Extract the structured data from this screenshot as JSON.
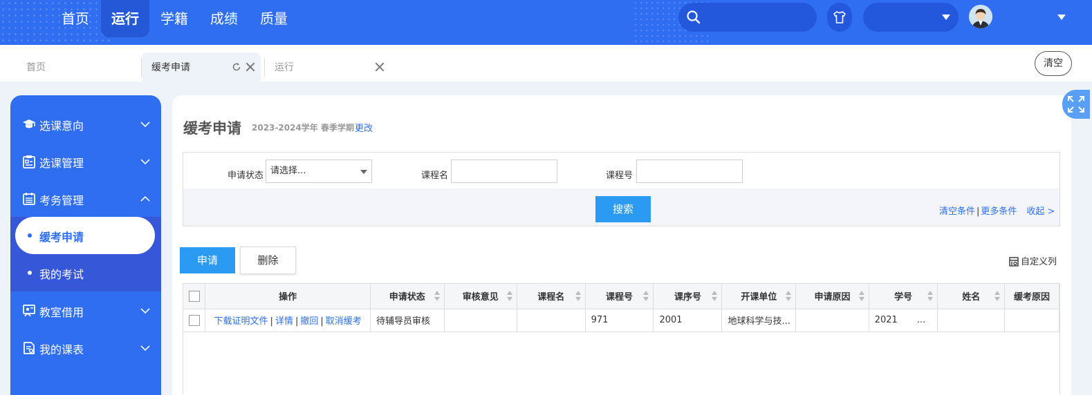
{
  "topnav": {
    "items": [
      {
        "label": "首页",
        "active": false
      },
      {
        "label": "运行",
        "active": true
      },
      {
        "label": "学籍",
        "active": false
      },
      {
        "label": "成绩",
        "active": false
      },
      {
        "label": "质量",
        "active": false
      }
    ],
    "search_placeholder": "",
    "role_value": ""
  },
  "tabs": {
    "items": [
      {
        "label": "首页"
      },
      {
        "label": "缓考申请"
      },
      {
        "label": "运行"
      }
    ],
    "clear_label": "清空"
  },
  "sidebar": {
    "items": [
      {
        "label": "选课意向",
        "icon": "graduation-cap-icon",
        "expanded": false
      },
      {
        "label": "选课管理",
        "icon": "clipboard-icon",
        "expanded": false
      },
      {
        "label": "考务管理",
        "icon": "calendar-icon",
        "expanded": true
      },
      {
        "label": "教室借用",
        "icon": "classroom-icon",
        "expanded": false
      },
      {
        "label": "我的课表",
        "icon": "schedule-icon",
        "expanded": false
      }
    ],
    "sub_items": [
      {
        "label": "缓考申请",
        "active": true
      },
      {
        "label": "我的考试",
        "active": false
      }
    ]
  },
  "main": {
    "title": "缓考申请",
    "term": "2023-2024学年 春季学期",
    "change_link": "更改",
    "filter": {
      "status_label": "申请状态",
      "status_value": "请选择...",
      "course_name_label": "课程名",
      "course_name_value": "",
      "course_no_label": "课程号",
      "course_no_value": "",
      "search_label": "搜索",
      "clear_conditions": "清空条件",
      "separator": "|",
      "more_conditions": "更多条件",
      "collapse": "收起 >"
    },
    "apply_label": "申请",
    "delete_label": "删除",
    "custom_columns_label": "自定义列",
    "table": {
      "columns": [
        "操作",
        "申请状态",
        "审核意见",
        "课程名",
        "课程号",
        "课序号",
        "开课单位",
        "申请原因",
        "学号",
        "姓名",
        "缓考原因"
      ],
      "rows": [
        {
          "actions": [
            "下载证明文件",
            "详情",
            "撤回",
            "取消缓考"
          ],
          "action_sep": "|",
          "status": "待辅导员审核",
          "opinion": "",
          "course_name": "",
          "course_no": "971",
          "seq_no": "2001",
          "dept": "地球科学与技...",
          "reason": "",
          "student_no": "2021",
          "student_no_ellipsis": "...",
          "name": "",
          "exam_reason": ""
        }
      ]
    }
  },
  "colors": {
    "primary": "#2f6ef0",
    "nav_active": "#2458d6",
    "button_blue": "#2b9af3",
    "sidebar_sub_bg": "#3657d8"
  }
}
